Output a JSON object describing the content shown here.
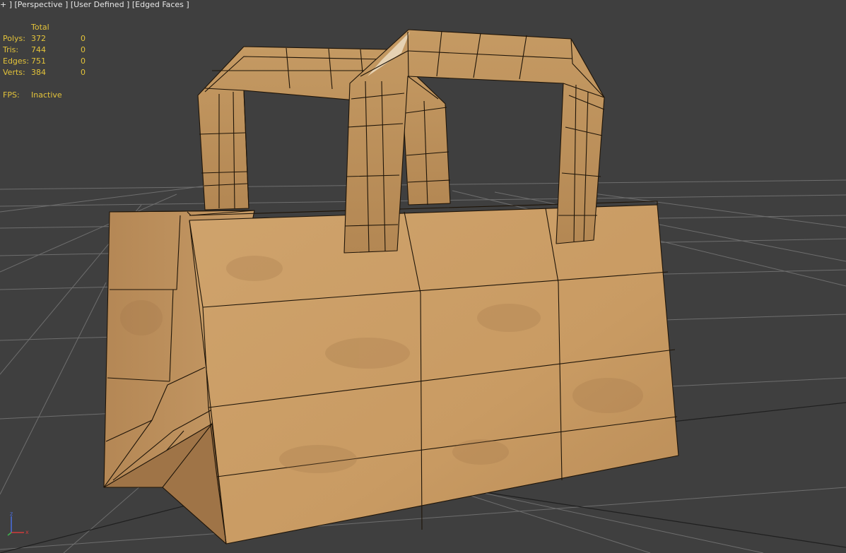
{
  "viewport_label": {
    "plus": "+",
    "bracket_open": "]",
    "view": "[Perspective ]",
    "shading": "[User Defined ]",
    "display": "[Edged Faces ]"
  },
  "stats": {
    "header": "Total",
    "rows": [
      {
        "label": "Polys:",
        "total": "372",
        "selected": "0"
      },
      {
        "label": "Tris:",
        "total": "744",
        "selected": "0"
      },
      {
        "label": "Edges:",
        "total": "751",
        "selected": "0"
      },
      {
        "label": "Verts:",
        "total": "384",
        "selected": "0"
      }
    ],
    "fps_label": "FPS:",
    "fps_value": "Inactive"
  },
  "axis_gizmo": {
    "z": "z",
    "x": "x"
  },
  "colors": {
    "background": "#3f3f3f",
    "grid_line": "#6e6e6e",
    "stats_text": "#e3c33a",
    "bag_kraft": "#c79a63",
    "bag_shade": "#a87d4e",
    "edge": "#1e1408",
    "axis_x": "#d23b3b",
    "axis_y": "#3fb34f",
    "axis_z": "#4a6fe0"
  },
  "icons": [
    "axis-gizmo-icon"
  ]
}
